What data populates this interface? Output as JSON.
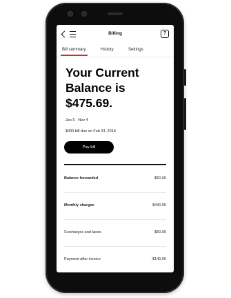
{
  "header": {
    "title": "Billing",
    "help_glyph": "?"
  },
  "tabs": [
    {
      "label": "Bill summary",
      "active": true
    },
    {
      "label": "History"
    },
    {
      "label": "Settings"
    }
  ],
  "accent_color": "#d52b1e",
  "balance": {
    "heading": "Your Current Balance is $475.69."
  },
  "bill": {
    "range": "Jan 5 - Nov 4",
    "due": "$400 bill due on Feb 24, 2018",
    "pay_label": "Pay bill"
  },
  "rows": [
    {
      "label": "Balance forwarded",
      "amount": "$50.00",
      "bold": true
    },
    {
      "label": "Monthly charges",
      "amount": "$440.00",
      "bold": true
    },
    {
      "label": "Surcharges and taxes",
      "amount": "$50.00"
    },
    {
      "label": "Payment after invoice",
      "amount": "-$140.00"
    }
  ]
}
